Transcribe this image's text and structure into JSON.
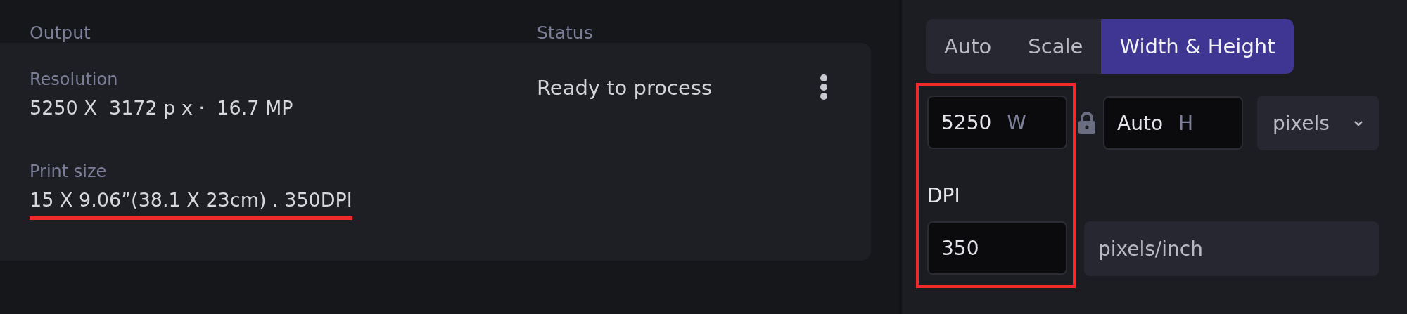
{
  "table_header": {
    "columns": [
      "Output",
      "Status"
    ]
  },
  "output": {
    "fields": [
      {
        "label": "Resolution",
        "value": "5250 X  3172 p x ·  16.7 MP",
        "underlined": false
      },
      {
        "label": "Print size",
        "value": "15 X 9.06”(38.1 X 23cm) . 350DPI",
        "underlined": true
      }
    ]
  },
  "status": "Ready to process",
  "mode_tabs": [
    {
      "label": "Auto",
      "selected": false
    },
    {
      "label": "Scale",
      "selected": false
    },
    {
      "label": "Width & Height",
      "selected": true
    }
  ],
  "size": {
    "highlighted": true,
    "locked": true,
    "width": {
      "value": "5250",
      "suffix": "W"
    },
    "height": {
      "value": "Auto",
      "suffix": "H"
    },
    "unit": "pixels"
  },
  "dpi": {
    "label": "DPI",
    "value": "350",
    "unit": "pixels/inch"
  }
}
